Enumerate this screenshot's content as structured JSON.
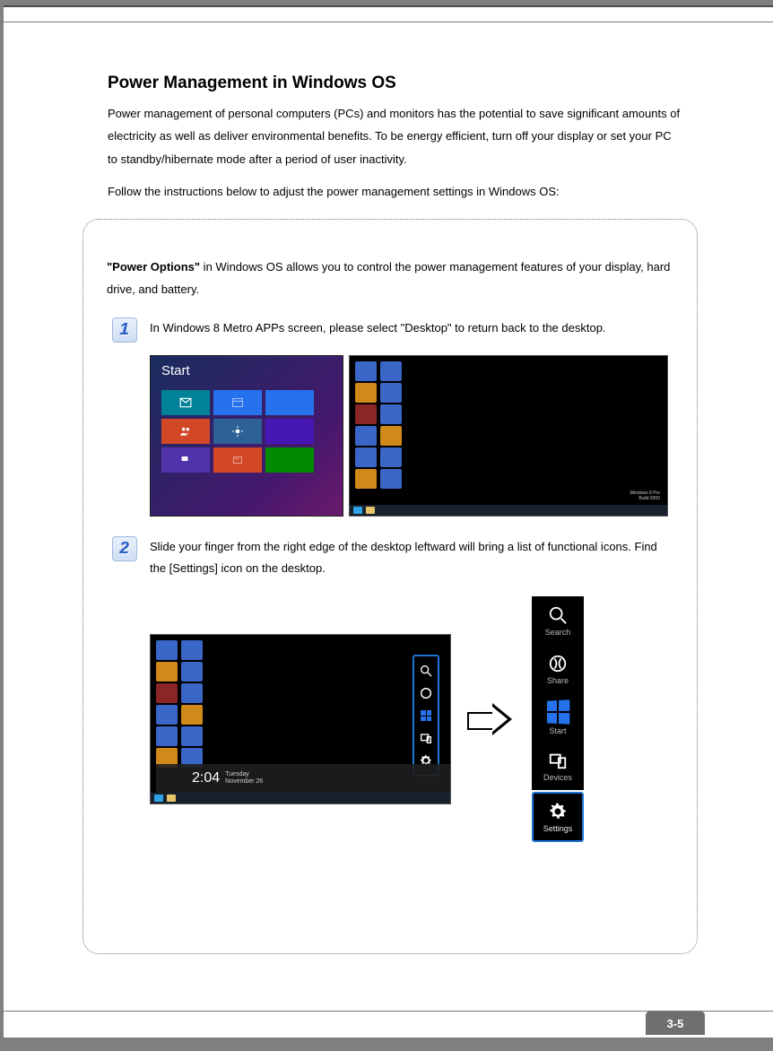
{
  "page_number": "3-5",
  "heading": "Power Management in Windows OS",
  "intro": "Power management of personal computers (PCs) and monitors has the potential to save significant amounts of electricity as well as deliver environmental benefits. To be energy efficient, turn off your display or set your PC to standby/hibernate mode after a period of user inactivity.",
  "follow": "Follow the instructions below to adjust the power management settings in Windows OS:",
  "box": {
    "power_options_lead": "\"Power Options\"",
    "power_options_rest": " in Windows OS allows you to control the power management features of your display, hard drive, and battery.",
    "step1_num": "1",
    "step1_text": "In Windows 8 Metro APPs screen, please select \"Desktop\" to return back to the desktop.",
    "start_label": "Start",
    "winpro_line1": "Windows 8 Pro",
    "winpro_line2": "Build 9200",
    "step2_num": "2",
    "step2_text": "Slide your finger from the right edge of the desktop leftward will bring a list of functional icons. Find the [Settings] icon on the desktop.",
    "clock_time": "2:04",
    "clock_day": "Tuesday",
    "clock_date": "November 26",
    "charms": {
      "search": "Search",
      "share": "Share",
      "start": "Start",
      "devices": "Devices",
      "settings": "Settings"
    }
  }
}
